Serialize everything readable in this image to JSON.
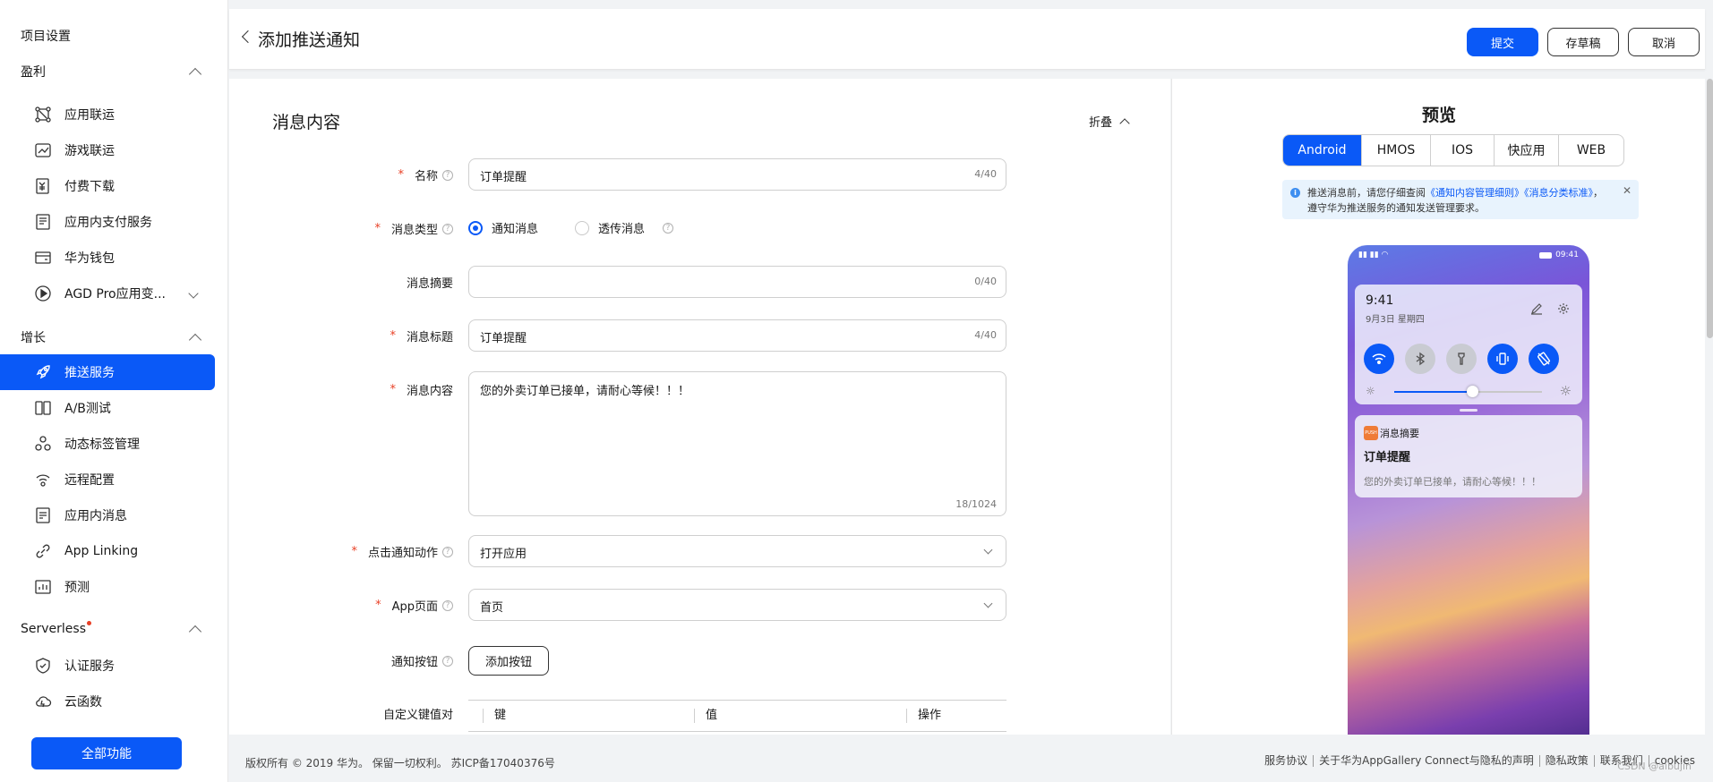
{
  "sidebar": {
    "project_settings": "项目设置",
    "groups": [
      {
        "label": "盈利"
      },
      {
        "label": "增长"
      },
      {
        "label": "Serverless"
      }
    ],
    "items": [
      {
        "label": "应用联运"
      },
      {
        "label": "游戏联运"
      },
      {
        "label": "付费下载"
      },
      {
        "label": "应用内支付服务"
      },
      {
        "label": "华为钱包"
      },
      {
        "label": "AGD Pro应用变..."
      },
      {
        "label": "推送服务"
      },
      {
        "label": "A/B测试"
      },
      {
        "label": "动态标签管理"
      },
      {
        "label": "远程配置"
      },
      {
        "label": "应用内消息"
      },
      {
        "label": "App Linking"
      },
      {
        "label": "预测"
      },
      {
        "label": "认证服务"
      },
      {
        "label": "云函数"
      }
    ],
    "all_functions": "全部功能",
    "active_color": "#0a59f7"
  },
  "header": {
    "title": "添加推送通知",
    "submit": "提交",
    "save_draft": "存草稿",
    "cancel": "取消"
  },
  "form": {
    "section_title": "消息内容",
    "fold": "折叠",
    "name": {
      "label": "名称",
      "value": "订单提醒",
      "count": "4/40"
    },
    "msg_type": {
      "label": "消息类型",
      "options": [
        "通知消息",
        "透传消息"
      ],
      "selected": "通知消息"
    },
    "summary": {
      "label": "消息摘要",
      "value": "",
      "count": "0/40"
    },
    "msg_title": {
      "label": "消息标题",
      "value": "订单提醒",
      "count": "4/40"
    },
    "content": {
      "label": "消息内容",
      "value": "您的外卖订单已接单，请耐心等候！！！",
      "count": "18/1024"
    },
    "click_action": {
      "label": "点击通知动作",
      "value": "打开应用"
    },
    "app_page": {
      "label": "App页面",
      "value": "首页"
    },
    "notif_button": {
      "label": "通知按钮",
      "button": "添加按钮"
    },
    "kv": {
      "label": "自定义键值对",
      "columns": [
        "键",
        "值",
        "操作"
      ]
    }
  },
  "preview": {
    "title": "预览",
    "tabs": [
      "Android",
      "HMOS",
      "IOS",
      "快应用",
      "WEB"
    ],
    "active_tab": "Android",
    "notice": {
      "pre": "推送消息前，请您仔细查阅",
      "link1": "《通知内容管理细则》",
      "link2": "《消息分类标准》",
      "post": "，遵守华为推送服务的通知发送管理要求。"
    },
    "phone": {
      "status_time": "09:41",
      "time": "9:41",
      "date": "9月3日 星期四",
      "notif_app": "消息摘要",
      "notif_logo": "PUSH",
      "notif_title": "订单提醒",
      "notif_body": "您的外卖订单已接单，请耐心等候！！！",
      "brightness": 0.53
    }
  },
  "footer": {
    "copyright": "版权所有 © 2019 华为。 保留一切权利。 苏ICP备17040376号",
    "links": [
      "服务协议",
      "关于华为AppGallery Connect与隐私的声明",
      "隐私政策",
      "联系我们",
      "cookies"
    ],
    "watermark": "CSDN @aibujin"
  }
}
